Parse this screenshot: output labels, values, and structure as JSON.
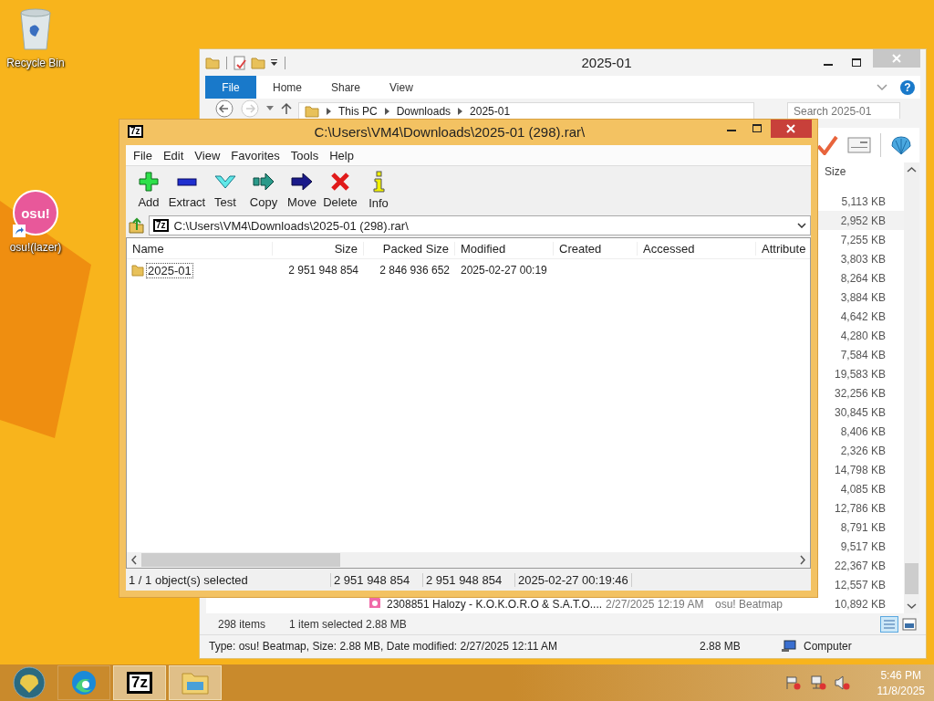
{
  "desktop_icons": [
    {
      "kind": "recycle",
      "label": "Recycle Bin"
    },
    {
      "kind": "osu",
      "label": "osu!(lazer)",
      "badge": "osu!"
    }
  ],
  "explorer": {
    "title": "2025-01",
    "file_tab": "File",
    "tabs": [
      "Home",
      "Share",
      "View"
    ],
    "help": "?",
    "crumbs": [
      "This PC",
      "Downloads",
      "2025-01"
    ],
    "search": {
      "placeholder": "Search 2025-01"
    },
    "tools": [
      {
        "kind": "check"
      },
      {
        "kind": "card"
      },
      {
        "kind": "shell"
      }
    ],
    "size_header": "Size",
    "rows": [
      {
        "size": "5,113 KB",
        "selected": false
      },
      {
        "size": "2,952 KB",
        "selected": true
      },
      {
        "size": "7,255 KB",
        "selected": false
      },
      {
        "size": "3,803 KB",
        "selected": false
      },
      {
        "size": "8,264 KB",
        "selected": false
      },
      {
        "size": "3,884 KB",
        "selected": false
      },
      {
        "size": "4,642 KB",
        "selected": false
      },
      {
        "size": "4,280 KB",
        "selected": false
      },
      {
        "size": "7,584 KB",
        "selected": false
      },
      {
        "size": "19,583 KB",
        "selected": false
      },
      {
        "size": "32,256 KB",
        "selected": false
      },
      {
        "size": "30,845 KB",
        "selected": false
      },
      {
        "size": "8,406 KB",
        "selected": false
      },
      {
        "size": "2,326 KB",
        "selected": false
      },
      {
        "size": "14,798 KB",
        "selected": false
      },
      {
        "size": "4,085 KB",
        "selected": false
      },
      {
        "size": "12,786 KB",
        "selected": false
      },
      {
        "size": "8,791 KB",
        "selected": false
      },
      {
        "size": "9,517 KB",
        "selected": false
      },
      {
        "size": "22,367 KB",
        "selected": false
      },
      {
        "size": "12,557 KB",
        "selected": false
      },
      {
        "name": "2308851 Halozy - K.O.K.O.R.O & S.A.T.O....",
        "modified": "2/27/2025 12:19 AM",
        "type": "osu! Beatmap",
        "size": "10,892 KB",
        "selected": false
      }
    ],
    "item_count": "298 items",
    "selection_info": "1 item selected  2.88 MB",
    "status_bar": {
      "details": "Type: osu! Beatmap, Size: 2.88 MB, Date modified: 2/27/2025 12:11 AM",
      "size": "2.88 MB",
      "location": "Computer"
    }
  },
  "sevenzip": {
    "title_icon": "7z",
    "title": "C:\\Users\\VM4\\Downloads\\2025-01 (298).rar\\",
    "menu": [
      "File",
      "Edit",
      "View",
      "Favorites",
      "Tools",
      "Help"
    ],
    "toolbar": [
      {
        "kind": "add",
        "label": "Add"
      },
      {
        "kind": "extract",
        "label": "Extract"
      },
      {
        "kind": "test",
        "label": "Test"
      },
      {
        "kind": "copy",
        "label": "Copy"
      },
      {
        "kind": "move",
        "label": "Move"
      },
      {
        "kind": "delete",
        "label": "Delete"
      },
      {
        "kind": "info",
        "label": "Info"
      }
    ],
    "path_icon": "7z",
    "path": "C:\\Users\\VM4\\Downloads\\2025-01 (298).rar\\",
    "columns": [
      "Name",
      "Size",
      "Packed Size",
      "Modified",
      "Created",
      "Accessed",
      "Attribute"
    ],
    "rows": [
      {
        "name": "2025-01",
        "size": "2 951 948 854",
        "packed_size": "2 846 936 652",
        "modified": "2025-02-27 00:19",
        "focused": true
      }
    ],
    "status": [
      "1 / 1 object(s) selected",
      "2 951 948 854",
      "2 951 948 854",
      "2025-02-27 00:19:46"
    ]
  },
  "taskbar": {
    "apps": [
      {
        "kind": "edge",
        "active": false
      },
      {
        "kind": "sevenzip",
        "active": true,
        "icon_text": "7z"
      },
      {
        "kind": "explorer",
        "active": true
      }
    ],
    "tray": [
      {
        "kind": "flag"
      },
      {
        "kind": "network"
      },
      {
        "kind": "volume"
      }
    ],
    "time": "5:46 PM",
    "date": "11/8/2025"
  }
}
